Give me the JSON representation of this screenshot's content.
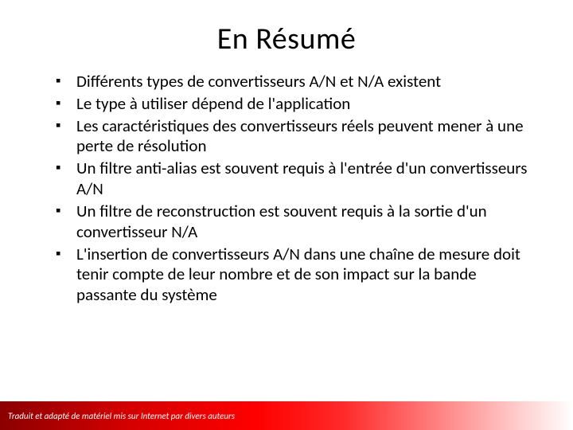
{
  "title": "En Résumé",
  "bullets": {
    "0": "Différents types de convertisseurs A/N et N/A existent",
    "1": "Le type à utiliser dépend de l'application",
    "2": "Les caractéristiques des convertisseurs réels peuvent mener à une perte de résolution",
    "3": "Un filtre anti-alias est souvent requis à l'entrée d'un convertisseurs A/N",
    "4": "Un filtre de reconstruction est souvent requis à la sortie d'un convertisseur N/A",
    "5": "L'insertion de convertisseurs A/N dans une chaîne de mesure doit tenir compte de leur nombre et de son impact sur la bande passante du système"
  },
  "footer": "Traduit et adapté de matériel mis sur Internet par divers auteurs"
}
